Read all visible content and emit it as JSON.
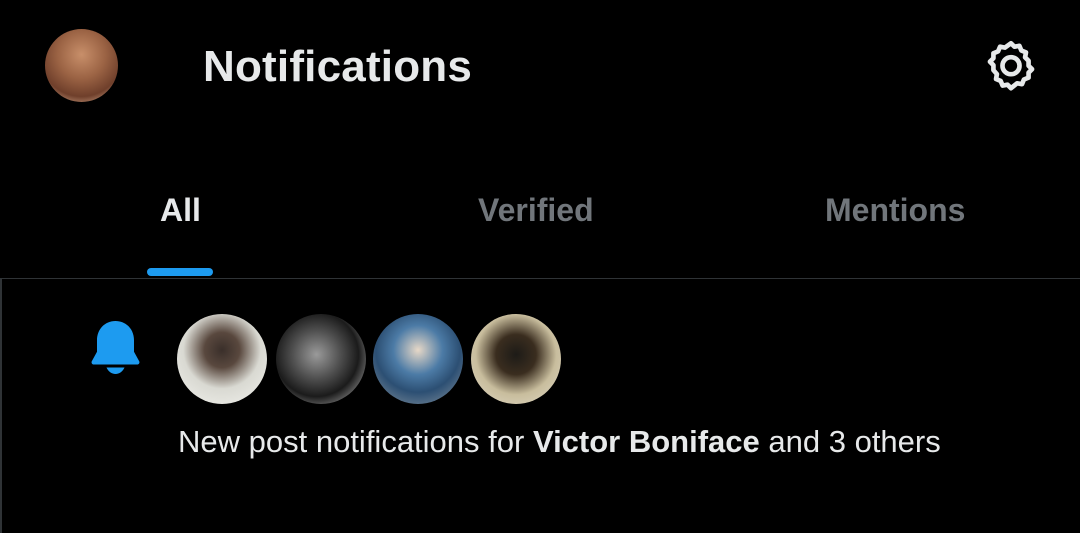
{
  "header": {
    "title": "Notifications",
    "profile_icon": "profile-avatar",
    "settings_icon": "gear-icon"
  },
  "tabs": [
    {
      "label": "All",
      "active": true
    },
    {
      "label": "Verified",
      "active": false
    },
    {
      "label": "Mentions",
      "active": false
    }
  ],
  "notification": {
    "icon": "bell-icon",
    "text_before": "New post notifications for ",
    "highlight_name": "Victor Boniface",
    "text_after": " and 3 others",
    "avatars": [
      "avatar-1",
      "avatar-2",
      "avatar-3",
      "avatar-4"
    ]
  },
  "colors": {
    "background": "#000000",
    "accent": "#1d9bf0",
    "primary_text": "#e7e9ea",
    "secondary_text": "#71767b",
    "border": "#2f3336"
  }
}
